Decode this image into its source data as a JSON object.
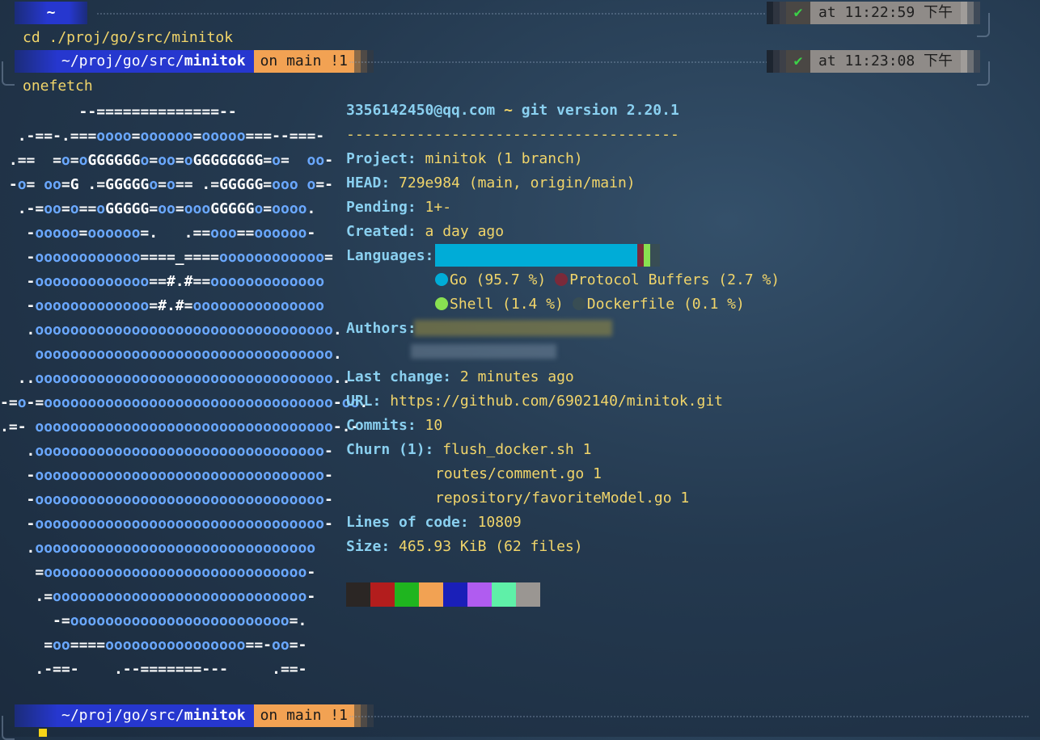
{
  "prompt1": {
    "path": "~",
    "time": "at 11:22:59 下午",
    "check": "✔"
  },
  "cmd1": "cd ./proj/go/src/minitok",
  "prompt2": {
    "path_prefix": "~/proj/go/src/",
    "path_bold": "minitok",
    "branch": "on main !1",
    "time": "at 11:23:08 下午",
    "check": "✔"
  },
  "cmd2": "onefetch",
  "info": {
    "header_user": "3356142450@qq.com",
    "header_sep": " ~ ",
    "header_git": "git version 2.20.1",
    "underline": "--------------------------------------",
    "project_key": "Project:",
    "project_val": "minitok (1 branch)",
    "head_key": "HEAD:",
    "head_val": "729e984 (main, origin/main)",
    "pending_key": "Pending:",
    "pending_val": "1+-",
    "created_key": "Created:",
    "created_val": "a day ago",
    "languages_key": "Languages:",
    "languages": [
      {
        "name": "Go (95.7 %)",
        "color": "#00acd7",
        "share": 0.957
      },
      {
        "name": "Protocol Buffers (2.7 %)",
        "color": "#7a2a3a",
        "share": 0.027
      },
      {
        "name": "Shell (1.4 %)",
        "color": "#89e051",
        "share": 0.014
      },
      {
        "name": "Dockerfile (0.1 %)",
        "color": "#384d54",
        "share": 0.001
      }
    ],
    "authors_key": "Authors:",
    "last_change_key": "Last change:",
    "last_change_val": "2 minutes ago",
    "url_key": "URL:",
    "url_val": "https://github.com/6902140/minitok.git",
    "commits_key": "Commits:",
    "commits_val": "10",
    "churn_key": "Churn (1):",
    "churn": [
      "flush_docker.sh 1",
      "routes/comment.go 1",
      "repository/favoriteModel.go 1"
    ],
    "loc_key": "Lines of code:",
    "loc_val": "10809",
    "size_key": "Size:",
    "size_val": "465.93 KiB (62 files)"
  },
  "palette": [
    "#2b2624",
    "#b31d1d",
    "#1fb51f",
    "#f2a253",
    "#1a1fb8",
    "#b05cf0",
    "#5ff0a8",
    "#9a9692"
  ],
  "prompt3": {
    "path_prefix": "~/proj/go/src/",
    "path_bold": "minitok",
    "branch": "on main !1"
  },
  "art": [
    "         --==============--",
    "  .-==-.===oooo=oooooo=ooooo===--===-",
    " .==  =o=oGGGGGGo=oo=oGGGGGGGG=o=  oo-",
    " -o= oo=G .=GGGGGo=o== .=GGGGG=ooo o=-",
    "  .-=oo=o==oGGGGG=oo=oooGGGGGo=oooo.",
    "   -ooooo=oooooo=.   .==ooo==oooooo-",
    "   -oooooooooooo====_====oooooooooooo=",
    "   -ooooooooooooo==#.#==ooooooooooooo",
    "   -ooooooooooooo=#.#=ooooooooooooooo",
    "   .oooooooooooooooooooooooooooooooooo.",
    "    oooooooooooooooooooooooooooooooooo.",
    "  ..oooooooooooooooooooooooooooooooooo..",
    "-=o-=ooooooooooooooooooooooooooooooooo-oo.",
    ".=- oooooooooooooooooooooooooooooooooo-.-",
    "   .ooooooooooooooooooooooooooooooooo-",
    "   -ooooooooooooooooooooooooooooooooo-",
    "   -ooooooooooooooooooooooooooooooooo-",
    "   -ooooooooooooooooooooooooooooooooo-",
    "   .oooooooooooooooooooooooooooooooo",
    "    =oooooooooooooooooooooooooooooo-",
    "    .=ooooooooooooooooooooooooooooo-",
    "      -=ooooooooooooooooooooooooo=.",
    "     =oo====oooooooooooooooo==-oo=-",
    "    .-==-    .--=======---     .==-"
  ]
}
